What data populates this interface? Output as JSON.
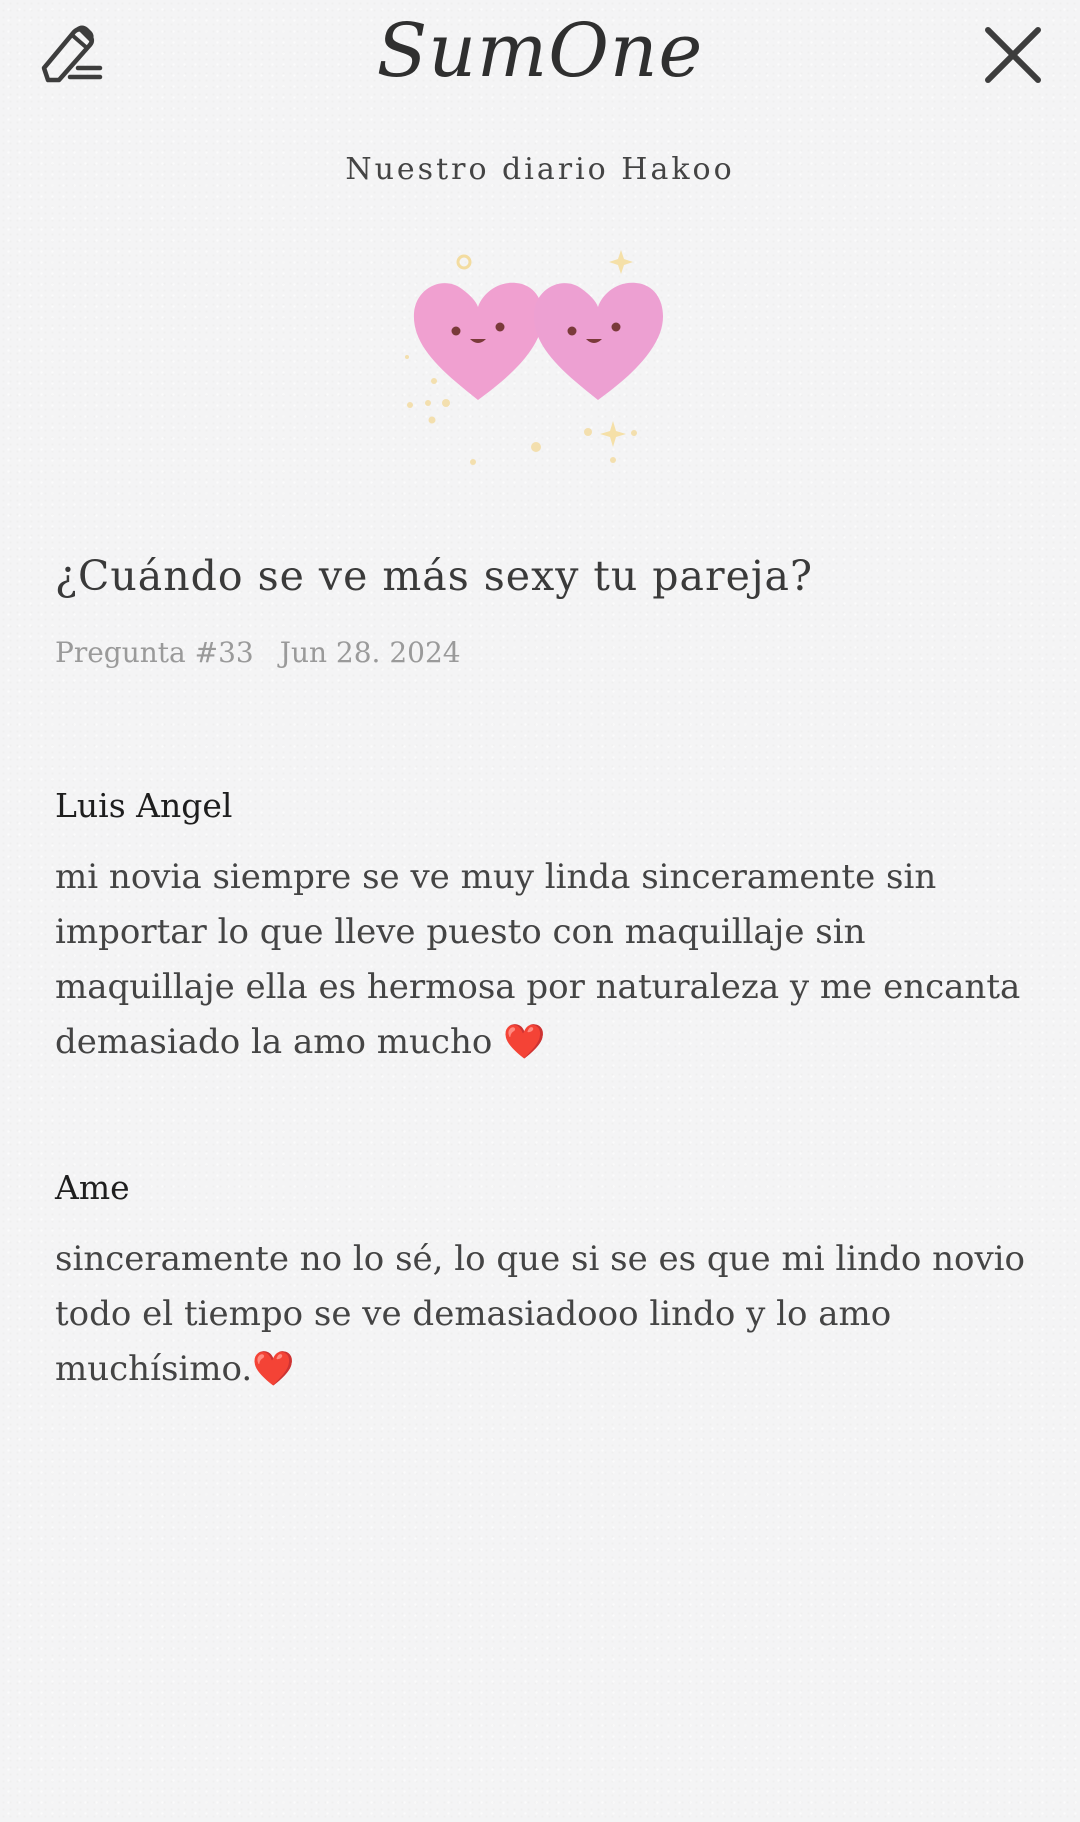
{
  "header": {
    "app_name": "SumOne",
    "edit_icon": "pen-edit-icon",
    "close_icon": "close-icon"
  },
  "diary": {
    "title": "Nuestro diario Hakoo"
  },
  "illustration": {
    "name": "two-hearts-illustration",
    "heart_color": "#f0a0d0"
  },
  "question": {
    "text": "¿Cuándo se ve más sexy tu pareja?",
    "number_label": "Pregunta #33",
    "date": "Jun 28. 2024"
  },
  "answers": [
    {
      "author": "Luis Angel",
      "text": "mi novia siempre se ve muy linda sinceramente sin importar lo que lleve puesto con maquillaje sin maquillaje ella es hermosa por naturaleza y me encanta demasiado la amo mucho ❤️"
    },
    {
      "author": "Ame",
      "text": "sinceramente no lo sé, lo que si se es que mi lindo novio todo el tiempo se ve demasiadooo lindo y lo amo muchísimo.❤️"
    }
  ]
}
